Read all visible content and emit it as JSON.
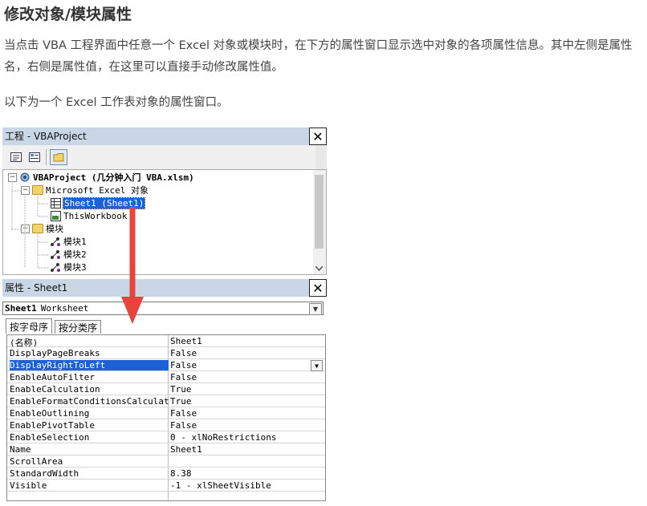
{
  "article": {
    "heading": "修改对象/模块属性",
    "para1": "当点击 VBA 工程界面中任意一个 Excel 对象或模块时，在下方的属性窗口显示选中对象的各项属性信息。其中左侧是属性名，右侧是属性值，在这里可以直接手动修改属性值。",
    "para2": "以下为一个 Excel 工作表对象的属性窗口。"
  },
  "project_window": {
    "title": "工程 - VBAProject",
    "close": "✕",
    "tree": {
      "root": "VBAProject (几分钟入门 VBA.xlsm)",
      "excel_objects": "Microsoft Excel 对象",
      "sheet1": "Sheet1 (Sheet1)",
      "this_workbook": "ThisWorkbook",
      "modules": "模块",
      "module1": "模块1",
      "module2": "模块2",
      "module3": "模块3"
    }
  },
  "properties_window": {
    "title": "属性 - Sheet1",
    "close": "✕",
    "object_selector": {
      "name": "Sheet1",
      "type": "Worksheet"
    },
    "tabs": [
      "按字母序",
      "按分类序"
    ],
    "rows": [
      {
        "name": "(名称)",
        "value": "Sheet1"
      },
      {
        "name": "DisplayPageBreaks",
        "value": "False"
      },
      {
        "name": "DisplayRightToLeft",
        "value": "False"
      },
      {
        "name": "EnableAutoFilter",
        "value": "False"
      },
      {
        "name": "EnableCalculation",
        "value": "True"
      },
      {
        "name": "EnableFormatConditionsCalculation",
        "value": "True"
      },
      {
        "name": "EnableOutlining",
        "value": "False"
      },
      {
        "name": "EnablePivotTable",
        "value": "False"
      },
      {
        "name": "EnableSelection",
        "value": "0 - xlNoRestrictions"
      },
      {
        "name": "Name",
        "value": "Sheet1"
      },
      {
        "name": "ScrollArea",
        "value": ""
      },
      {
        "name": "StandardWidth",
        "value": "8.38"
      },
      {
        "name": "Visible",
        "value": "-1 - xlSheetVisible"
      }
    ],
    "selected_row": 2
  },
  "colors": {
    "title_bar": "#c9d6e6",
    "selection": "#1c61d6",
    "arrow": "#e8443c"
  }
}
